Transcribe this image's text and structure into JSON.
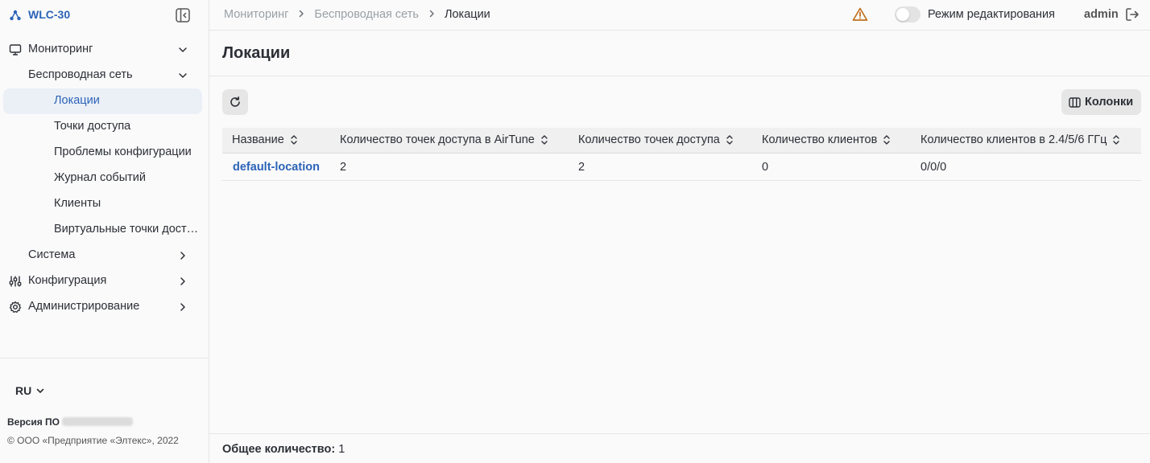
{
  "app": {
    "title": "WLC-30"
  },
  "sidebar": {
    "items": [
      {
        "label": "Мониторинг",
        "icon": "monitor-icon",
        "expanded": true
      },
      {
        "label": "Беспроводная сеть",
        "expanded": true
      },
      {
        "label": "Локации",
        "active": true
      },
      {
        "label": "Точки доступа"
      },
      {
        "label": "Проблемы конфигурации"
      },
      {
        "label": "Журнал событий"
      },
      {
        "label": "Клиенты"
      },
      {
        "label": "Виртуальные точки дост…"
      },
      {
        "label": "Система",
        "expanded": false
      },
      {
        "label": "Конфигурация",
        "icon": "sliders-icon",
        "expanded": false
      },
      {
        "label": "Администрирование",
        "icon": "gear-icon",
        "expanded": false
      }
    ],
    "language": "RU",
    "version_label": "Версия ПО",
    "copyright": "© ООО «Предприятие «Элтекс», 2022"
  },
  "header": {
    "breadcrumbs": [
      "Мониторинг",
      "Беспроводная сеть",
      "Локации"
    ],
    "edit_mode_label": "Режим редактирования",
    "edit_mode_on": false,
    "user": "admin"
  },
  "page": {
    "title": "Локации",
    "columns_button": "Колонки",
    "table": {
      "headers": [
        "Название",
        "Количество точек доступа в AirTune",
        "Количество точек доступа",
        "Количество клиентов",
        "Количество клиентов в 2.4/5/6 ГГц"
      ],
      "rows": [
        [
          "default-location",
          "2",
          "2",
          "0",
          "0/0/0"
        ]
      ]
    },
    "total_label": "Общее количество:",
    "total_value": "1"
  },
  "colors": {
    "accent": "#2b63b7",
    "warning": "#c0701e",
    "active_bg": "#ebf0f7"
  }
}
